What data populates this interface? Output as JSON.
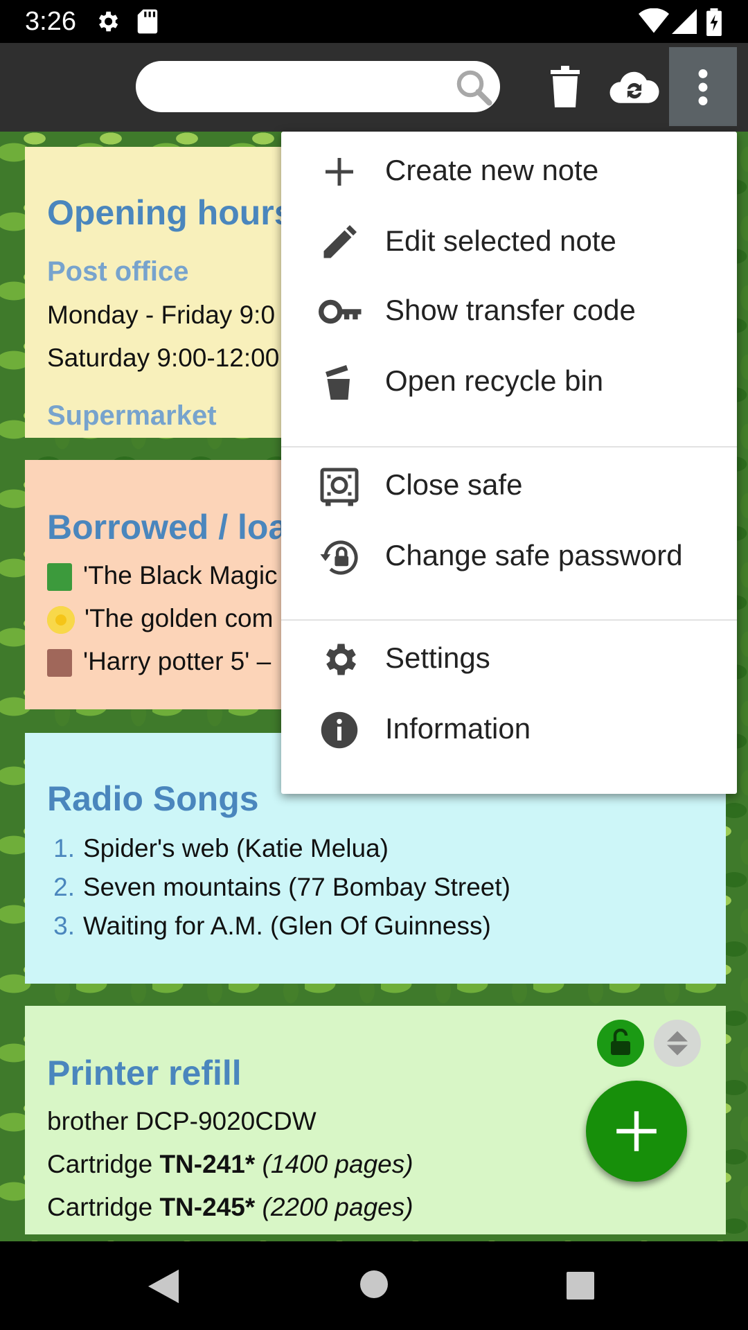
{
  "status_bar": {
    "time": "3:26"
  },
  "toolbar": {
    "search_placeholder": ""
  },
  "notes": [
    {
      "title": "Opening hours",
      "lines": [
        "Post office",
        "Monday - Friday 9:0",
        "Saturday 9:00-12:00",
        "Supermarket"
      ]
    },
    {
      "title": "Borrowed / loa",
      "lines": [
        "'The Black Magic",
        "'The golden com",
        "'Harry potter 5' –"
      ]
    },
    {
      "title": "Radio Songs",
      "list": [
        "Spider's web (Katie Melua)",
        "Seven mountains (77 Bombay Street)",
        "Waiting for A.M. (Glen Of Guinness)"
      ]
    },
    {
      "title": "Printer refill",
      "lines": [
        "brother DCP-9020CDW"
      ],
      "cartridges": [
        {
          "prefix": "Cartridge ",
          "code": "TN-241*",
          "pages": "(1400 pages)"
        },
        {
          "prefix": "Cartridge ",
          "code": "TN-245*",
          "pages": "(2200 pages)"
        }
      ]
    }
  ],
  "menu": {
    "items": [
      {
        "label": "Create new note",
        "icon": "plus-icon"
      },
      {
        "label": "Edit selected note",
        "icon": "pencil-icon"
      },
      {
        "label": "Show transfer code",
        "icon": "key-icon"
      },
      {
        "label": "Open recycle bin",
        "icon": "recycle-bin-icon"
      },
      {
        "label": "Close safe",
        "icon": "safe-icon"
      },
      {
        "label": "Change safe password",
        "icon": "lock-reset-icon"
      },
      {
        "label": "Settings",
        "icon": "gear-icon"
      },
      {
        "label": "Information",
        "icon": "info-icon"
      }
    ]
  },
  "colors": {
    "toolbar": "#2f2f2f",
    "accent_blue": "#4a86bd",
    "fab_green": "#178f0a"
  }
}
